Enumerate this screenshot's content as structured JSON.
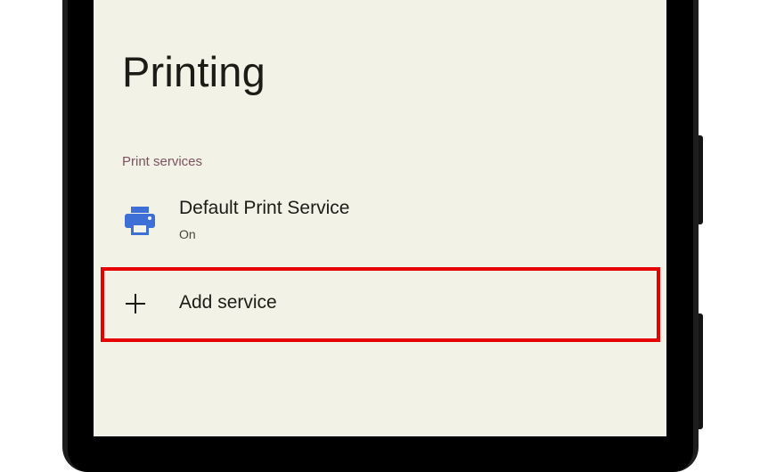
{
  "page": {
    "title": "Printing"
  },
  "sections": [
    {
      "header": "Print services",
      "items": [
        {
          "title": "Default Print Service",
          "summary": "On",
          "icon": "printer-icon"
        }
      ]
    }
  ],
  "add_service": {
    "label": "Add service",
    "icon": "plus-icon"
  },
  "colors": {
    "background": "#f2f2e6",
    "section_header": "#7d5260",
    "printer_icon": "#3d6fd6",
    "highlight": "#e60000"
  }
}
